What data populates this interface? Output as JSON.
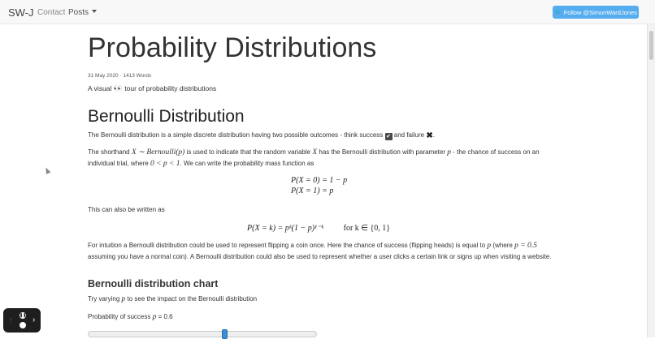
{
  "nav": {
    "brand": "SW-J",
    "contact": "Contact",
    "posts": "Posts",
    "follow_label": "Follow @SimonWardJones"
  },
  "article": {
    "title": "Probability Distributions",
    "meta": "31 May 2020 · 1413 Words",
    "subtitle_before": "A visual",
    "subtitle_after": "tour of probability distributions",
    "section_title": "Bernoulli Distribution",
    "p1_before": "The Bernoulli distribution is a simple discrete distribution having two possible outcomes - think success",
    "p1_mid": "and failure",
    "p1_after": ".",
    "p2_a": "The shorthand",
    "p2_math1": "X ∼ Bernoulli(p)",
    "p2_b": "is used to indicate that the random variable",
    "p2_math2": "X",
    "p2_c": "has the Bernoulli distribution with parameter",
    "p2_math3": "p",
    "p2_d": "- the chance of success on an individual trial, where",
    "p2_math4": "0 < p < 1",
    "p2_e": ". We can write the probability mass function as",
    "eq1": "P(X = 0) = 1 − p",
    "eq2": "P(X = 1) = p",
    "p3": "This can also be written as",
    "eq3": "P(X = k) = pᵏ(1 − p)¹⁻ᵏ",
    "eq3_cond": "for k ∈ {0, 1}",
    "p4_a": "For intuition a Bernoulli distribution could be used to represent flipping a coin once. Here the chance of success (flipping heads) is equal to",
    "p4_math1": "p",
    "p4_b": "(where",
    "p4_math2": "p = 0.5",
    "p4_c": "assuming you have a normal coin). A Bernoulli distribution could also be used to represent whether a user clicks a certain link or signs up when visiting a website.",
    "chart_title": "Bernoulli distribution chart",
    "hint_a": "Try varying",
    "hint_math": "p",
    "hint_b": "to see the impact on the Bernoulli distribution",
    "prob_label": "Probability of success",
    "prob_math": "p",
    "prob_value": "= 0.6"
  },
  "slider": {
    "min": 0,
    "max": 1,
    "value": 0.6
  },
  "icons": {
    "eyes": "👀",
    "check": "✔",
    "cross": "✖",
    "twitter": "🐦"
  },
  "colors": {
    "follow": "#55acee",
    "slider_thumb": "#3a8fd6"
  }
}
